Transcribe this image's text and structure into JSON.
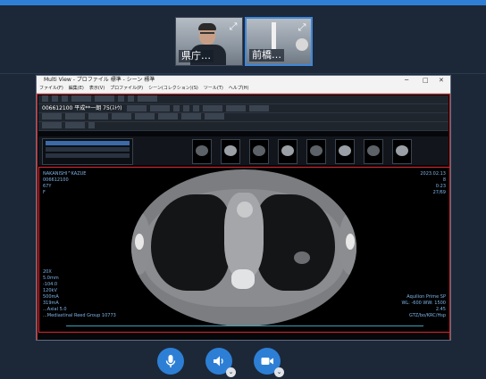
{
  "colors": {
    "accent": "#2d7fd6",
    "background": "#1c2838",
    "highlight_frame": "#d92a2a",
    "overlay_text": "#7fb4e8"
  },
  "participants": [
    {
      "name": "県庁…",
      "expand_icon": "expand-icon"
    },
    {
      "name": "前橋…",
      "expand_icon": "expand-icon"
    }
  ],
  "shared_window": {
    "title": "Multi View - プロファイル 標準 - シーン 標準",
    "window_controls": [
      "─",
      "□",
      "✕"
    ],
    "menu": [
      "ファイル(F)",
      "編集(E)",
      "表示(V)",
      "プロファイル(P)",
      "シーン(コレクション)(S)",
      "ツール(T)",
      "ヘルプ(H)"
    ],
    "patient_id_bar": "006612100 平成**一朗 75(ｽﾄｳ)",
    "overlay": {
      "top_left": "NAKANISHI^KAZUE\n006612100\n67Y\nF",
      "top_right": "2023.02.13\n8\n0:23\n27/69",
      "bottom_left": "20X\n5.0mm\n-104.0\n120kV\n500mA\n319mA\n...Axial 5.0\n...Mediastinal Reed Group 10773",
      "bottom_right": "Aquilion Prime SP\nWL: -600 WW: 1500\n2.45\nGTZ/bo/KRC/Hsp"
    }
  },
  "controls": {
    "mic": "microphone-icon",
    "speaker": "speaker-icon",
    "camera": "camera-icon"
  }
}
